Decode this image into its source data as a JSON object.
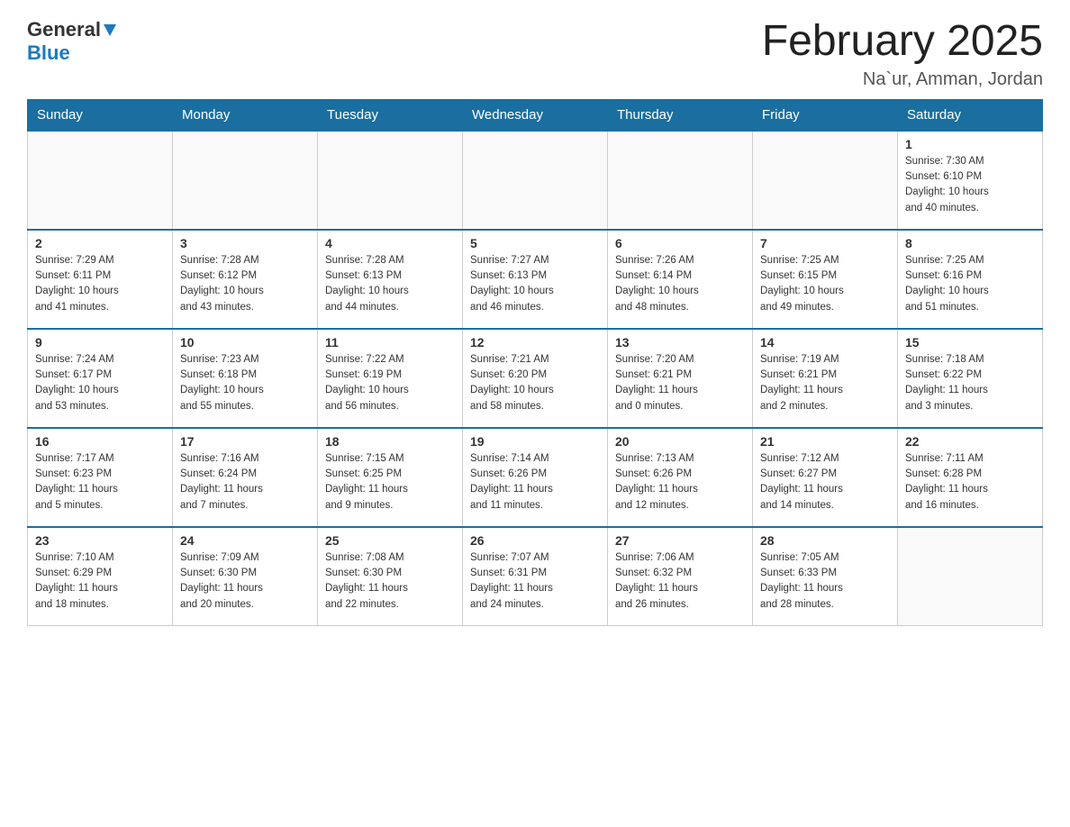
{
  "logo": {
    "general": "General",
    "blue": "Blue",
    "triangle": "▲"
  },
  "title": {
    "month": "February 2025",
    "location": "Na`ur, Amman, Jordan"
  },
  "weekdays": [
    "Sunday",
    "Monday",
    "Tuesday",
    "Wednesday",
    "Thursday",
    "Friday",
    "Saturday"
  ],
  "weeks": [
    [
      {
        "day": "",
        "info": ""
      },
      {
        "day": "",
        "info": ""
      },
      {
        "day": "",
        "info": ""
      },
      {
        "day": "",
        "info": ""
      },
      {
        "day": "",
        "info": ""
      },
      {
        "day": "",
        "info": ""
      },
      {
        "day": "1",
        "info": "Sunrise: 7:30 AM\nSunset: 6:10 PM\nDaylight: 10 hours\nand 40 minutes."
      }
    ],
    [
      {
        "day": "2",
        "info": "Sunrise: 7:29 AM\nSunset: 6:11 PM\nDaylight: 10 hours\nand 41 minutes."
      },
      {
        "day": "3",
        "info": "Sunrise: 7:28 AM\nSunset: 6:12 PM\nDaylight: 10 hours\nand 43 minutes."
      },
      {
        "day": "4",
        "info": "Sunrise: 7:28 AM\nSunset: 6:13 PM\nDaylight: 10 hours\nand 44 minutes."
      },
      {
        "day": "5",
        "info": "Sunrise: 7:27 AM\nSunset: 6:13 PM\nDaylight: 10 hours\nand 46 minutes."
      },
      {
        "day": "6",
        "info": "Sunrise: 7:26 AM\nSunset: 6:14 PM\nDaylight: 10 hours\nand 48 minutes."
      },
      {
        "day": "7",
        "info": "Sunrise: 7:25 AM\nSunset: 6:15 PM\nDaylight: 10 hours\nand 49 minutes."
      },
      {
        "day": "8",
        "info": "Sunrise: 7:25 AM\nSunset: 6:16 PM\nDaylight: 10 hours\nand 51 minutes."
      }
    ],
    [
      {
        "day": "9",
        "info": "Sunrise: 7:24 AM\nSunset: 6:17 PM\nDaylight: 10 hours\nand 53 minutes."
      },
      {
        "day": "10",
        "info": "Sunrise: 7:23 AM\nSunset: 6:18 PM\nDaylight: 10 hours\nand 55 minutes."
      },
      {
        "day": "11",
        "info": "Sunrise: 7:22 AM\nSunset: 6:19 PM\nDaylight: 10 hours\nand 56 minutes."
      },
      {
        "day": "12",
        "info": "Sunrise: 7:21 AM\nSunset: 6:20 PM\nDaylight: 10 hours\nand 58 minutes."
      },
      {
        "day": "13",
        "info": "Sunrise: 7:20 AM\nSunset: 6:21 PM\nDaylight: 11 hours\nand 0 minutes."
      },
      {
        "day": "14",
        "info": "Sunrise: 7:19 AM\nSunset: 6:21 PM\nDaylight: 11 hours\nand 2 minutes."
      },
      {
        "day": "15",
        "info": "Sunrise: 7:18 AM\nSunset: 6:22 PM\nDaylight: 11 hours\nand 3 minutes."
      }
    ],
    [
      {
        "day": "16",
        "info": "Sunrise: 7:17 AM\nSunset: 6:23 PM\nDaylight: 11 hours\nand 5 minutes."
      },
      {
        "day": "17",
        "info": "Sunrise: 7:16 AM\nSunset: 6:24 PM\nDaylight: 11 hours\nand 7 minutes."
      },
      {
        "day": "18",
        "info": "Sunrise: 7:15 AM\nSunset: 6:25 PM\nDaylight: 11 hours\nand 9 minutes."
      },
      {
        "day": "19",
        "info": "Sunrise: 7:14 AM\nSunset: 6:26 PM\nDaylight: 11 hours\nand 11 minutes."
      },
      {
        "day": "20",
        "info": "Sunrise: 7:13 AM\nSunset: 6:26 PM\nDaylight: 11 hours\nand 12 minutes."
      },
      {
        "day": "21",
        "info": "Sunrise: 7:12 AM\nSunset: 6:27 PM\nDaylight: 11 hours\nand 14 minutes."
      },
      {
        "day": "22",
        "info": "Sunrise: 7:11 AM\nSunset: 6:28 PM\nDaylight: 11 hours\nand 16 minutes."
      }
    ],
    [
      {
        "day": "23",
        "info": "Sunrise: 7:10 AM\nSunset: 6:29 PM\nDaylight: 11 hours\nand 18 minutes."
      },
      {
        "day": "24",
        "info": "Sunrise: 7:09 AM\nSunset: 6:30 PM\nDaylight: 11 hours\nand 20 minutes."
      },
      {
        "day": "25",
        "info": "Sunrise: 7:08 AM\nSunset: 6:30 PM\nDaylight: 11 hours\nand 22 minutes."
      },
      {
        "day": "26",
        "info": "Sunrise: 7:07 AM\nSunset: 6:31 PM\nDaylight: 11 hours\nand 24 minutes."
      },
      {
        "day": "27",
        "info": "Sunrise: 7:06 AM\nSunset: 6:32 PM\nDaylight: 11 hours\nand 26 minutes."
      },
      {
        "day": "28",
        "info": "Sunrise: 7:05 AM\nSunset: 6:33 PM\nDaylight: 11 hours\nand 28 minutes."
      },
      {
        "day": "",
        "info": ""
      }
    ]
  ]
}
